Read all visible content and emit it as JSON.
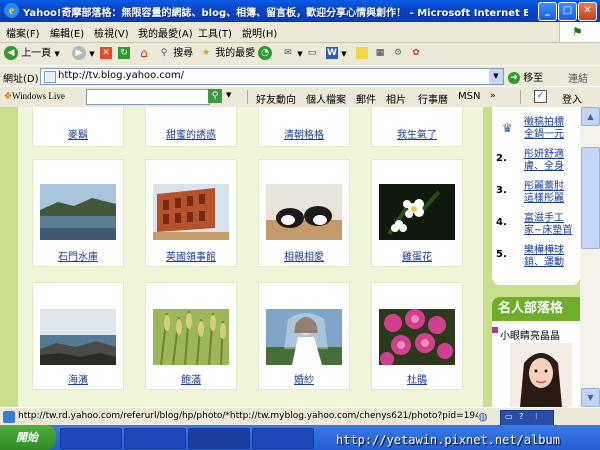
{
  "window": {
    "title": "Yahoo!奇摩部落格：無限容量的網誌、blog、相簿、留言板，歡迎分享心情與創作！ - Microsoft Internet Explorer",
    "app_icon": "ie-icon",
    "controls": [
      "minimize-icon",
      "maximize-icon",
      "close-icon"
    ]
  },
  "menu": {
    "items": [
      "檔案(F)",
      "編輯(E)",
      "檢視(V)",
      "我的最愛(A)",
      "工具(T)",
      "說明(H)"
    ]
  },
  "toolbar": {
    "back_label": "上一頁",
    "search_label": "搜尋",
    "favorites_label": "我的最愛"
  },
  "address": {
    "label": "網址(D)",
    "url": "http://tv.blog.yahoo.com/",
    "go_label": "移至",
    "links_label": "連結"
  },
  "livebar": {
    "logo": "Windows Live",
    "search_placeholder": "",
    "items": [
      "好友動向",
      "個人檔案",
      "郵件",
      "相片",
      "行事曆",
      "MSN"
    ],
    "signin_label": "登入"
  },
  "album": {
    "top_row": [
      "麥鬍",
      "甜蜜的誘惑",
      "清朝格格",
      "我生氣了"
    ],
    "rows": [
      [
        {
          "caption": "石門水庫",
          "icon": "reservoir-photo"
        },
        {
          "caption": "英國領事館",
          "icon": "brick-building-photo"
        },
        {
          "caption": "相親相愛",
          "icon": "dogs-photo"
        },
        {
          "caption": "雞蛋花",
          "icon": "frangipani-photo"
        }
      ],
      [
        {
          "caption": "海濱",
          "icon": "seaside-photo"
        },
        {
          "caption": "飽滿",
          "icon": "rice-photo"
        },
        {
          "caption": "婚紗",
          "icon": "bride-photo"
        },
        {
          "caption": "杜鵑",
          "icon": "azalea-photo"
        }
      ]
    ]
  },
  "sidebar": {
    "ranking": [
      {
        "rank": "",
        "text": "徵稿拍標",
        "text2": "全鍋一元",
        "icon": "crown-icon"
      },
      {
        "rank": "2.",
        "text": "彤妍舒適",
        "text2": "膚、全身"
      },
      {
        "rank": "3.",
        "text": "彤麗蕾肘",
        "text2": "這樣彤麗"
      },
      {
        "rank": "4.",
        "text": "富滋手工",
        "text2": "家~床墊首"
      },
      {
        "rank": "5.",
        "text": "樂樺樺球",
        "text2": "銷、運動"
      }
    ],
    "celebrity_title": "名人部落格",
    "celebrity_sub": "小眼睛亮晶晶"
  },
  "status": {
    "text": "http://tw.rd.yahoo.com/referurl/blog/hp/photo/*http://tw.myblog.yahoo.com/chenys621/photo?pid=1949"
  },
  "taskbar": {
    "start_label": "開始",
    "watermark": "http://yetawin.pixnet.net/album"
  }
}
